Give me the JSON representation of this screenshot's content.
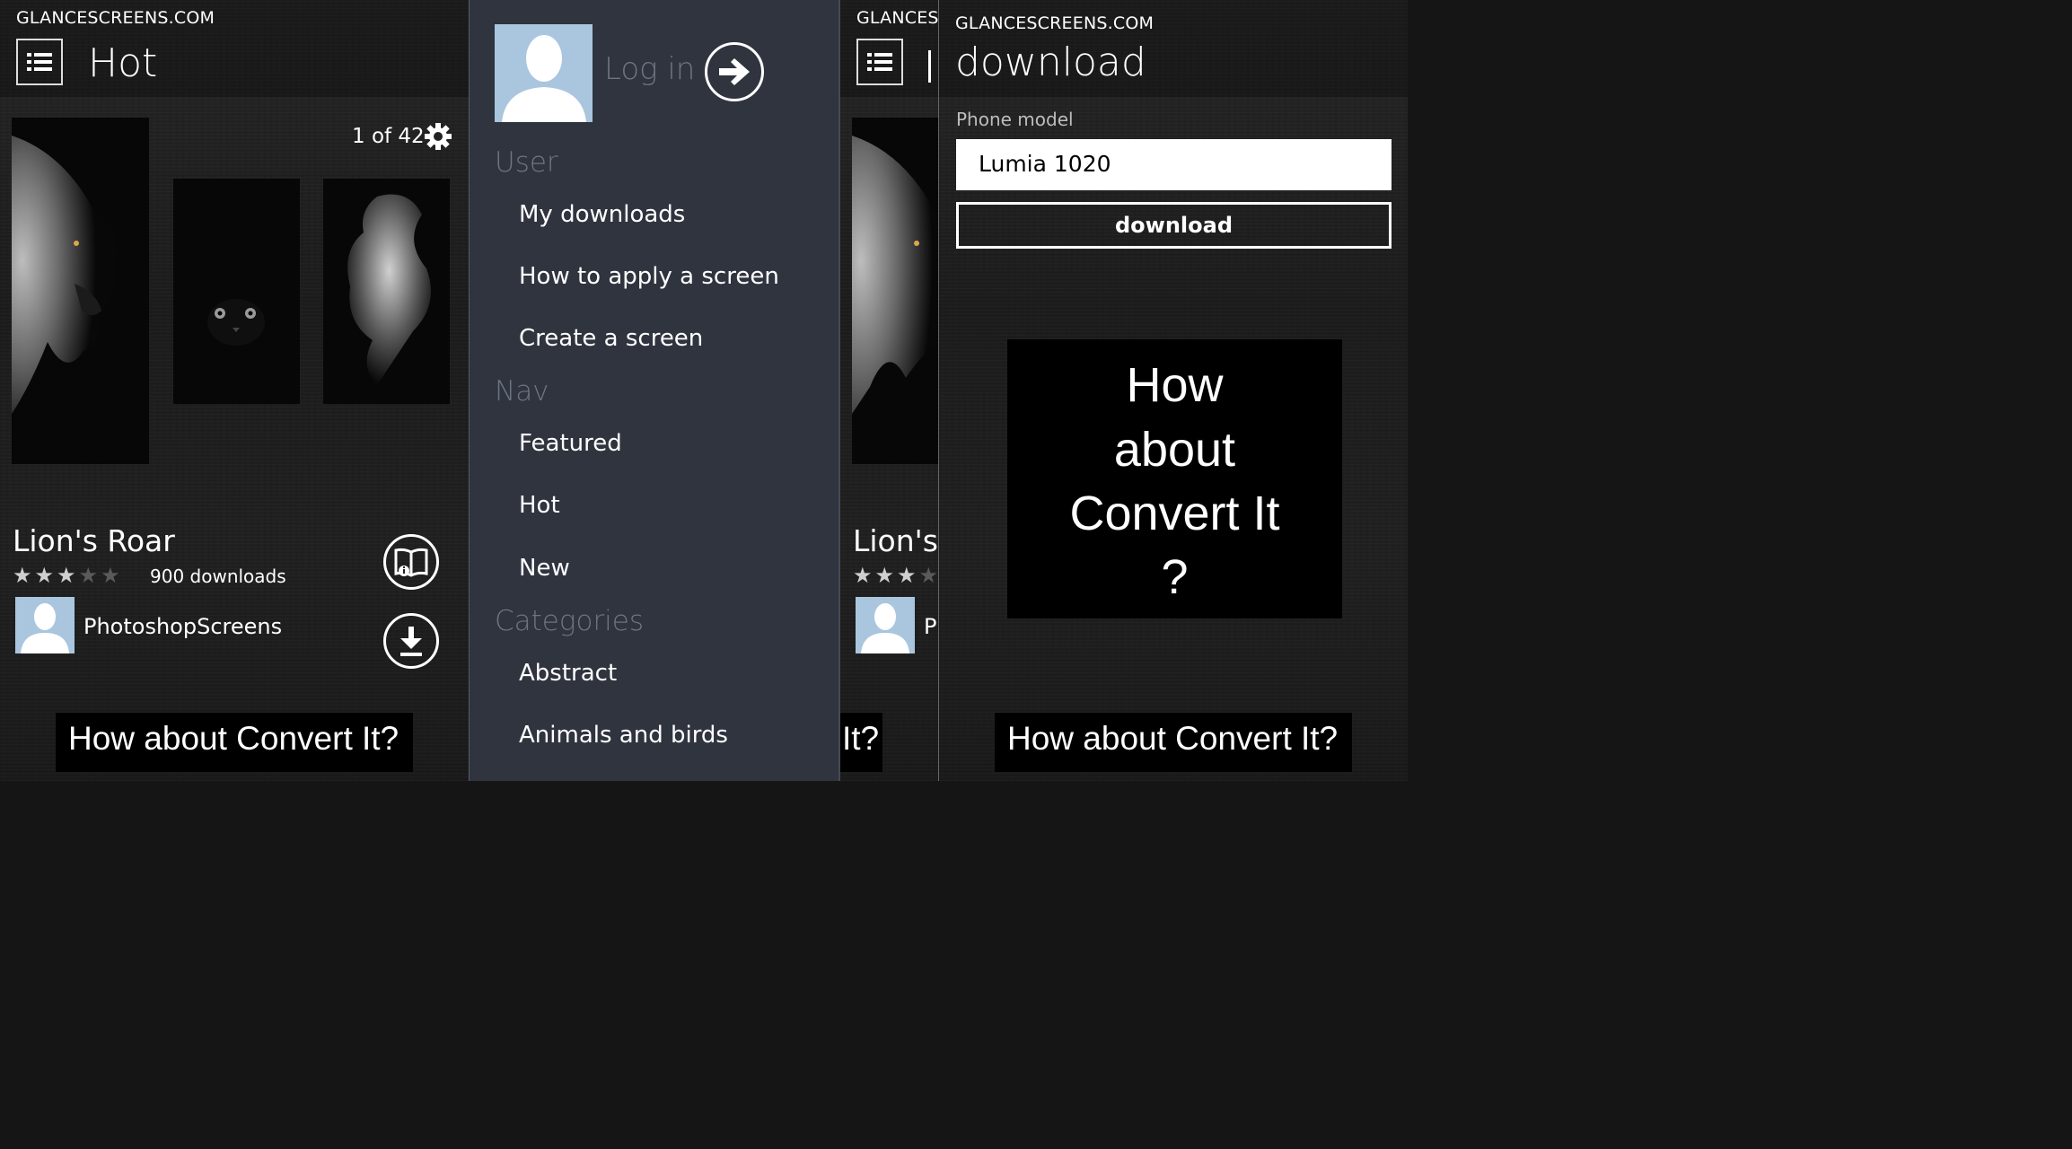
{
  "colors": {
    "menu_bg": "#2f343f",
    "section_heading": "#6e7481",
    "avatar": "#a9c6de",
    "ad_bg": "#000000"
  },
  "panel1": {
    "site": "GLANCESCREENS.COM",
    "title": "Hot",
    "counter": "1 of 42",
    "screen_name": "Lion's Roar",
    "rating": 3,
    "rating_max": 5,
    "downloads": "900 downloads",
    "author": "PhotoshopScreens",
    "ad": "How about Convert It?",
    "icons": {
      "menu": "list-icon",
      "settings": "gear-icon",
      "info": "book-info-icon",
      "download": "download-icon"
    }
  },
  "menu": {
    "login_label": "Log in",
    "sections": [
      {
        "heading": "User",
        "items": [
          "My downloads",
          "How to apply a screen",
          "Create a screen"
        ]
      },
      {
        "heading": "Nav",
        "items": [
          "Featured",
          "Hot",
          "New"
        ]
      },
      {
        "heading": "Categories",
        "items": [
          "Abstract",
          "Animals and birds"
        ]
      }
    ]
  },
  "panel3": {
    "site": "GLANCESC",
    "name_partial": "Lion's",
    "author_partial": "P",
    "ad_partial": "It?"
  },
  "panel4": {
    "site": "GLANCESCREENS.COM",
    "title": "download",
    "phone_model_label": "Phone model",
    "phone_model_value": "Lumia 1020",
    "download_button": "download",
    "promo_lines": [
      "How",
      "about",
      "Convert It",
      "?"
    ],
    "ad": "How about Convert It?"
  }
}
